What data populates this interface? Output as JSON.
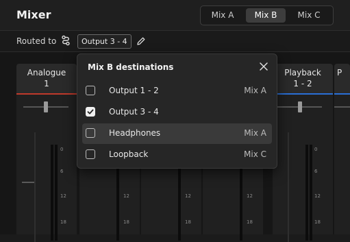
{
  "header": {
    "title": "Mixer",
    "tabs": [
      {
        "label": "Mix A",
        "active": false
      },
      {
        "label": "Mix B",
        "active": true
      },
      {
        "label": "Mix C",
        "active": false
      }
    ]
  },
  "routing": {
    "label": "Routed to",
    "icon": "route-icon",
    "output": "Output 3 - 4",
    "edit_icon": "pencil-icon"
  },
  "channels": [
    {
      "name_line1": "Analogue",
      "name_line2": "1",
      "stripe_color": "#c0392b",
      "pan": 0.5
    },
    {
      "name_line1": "Playback",
      "name_line2": "1 - 2",
      "stripe_color": "#2a6fd6",
      "pan": 0.5
    },
    {
      "name_line1": "P",
      "name_line2": "",
      "stripe_color": "#2a6fd6",
      "pan": 0.5
    }
  ],
  "meter_scale": [
    "0",
    "6",
    "12",
    "18"
  ],
  "dropdown": {
    "title": "Mix B destinations",
    "close_icon": "close-icon",
    "items": [
      {
        "label": "Output 1 - 2",
        "checked": false,
        "tag": "Mix A",
        "hover": false
      },
      {
        "label": "Output 3 - 4",
        "checked": true,
        "tag": "",
        "hover": false
      },
      {
        "label": "Headphones",
        "checked": false,
        "tag": "Mix A",
        "hover": true
      },
      {
        "label": "Loopback",
        "checked": false,
        "tag": "Mix C",
        "hover": false
      }
    ]
  }
}
